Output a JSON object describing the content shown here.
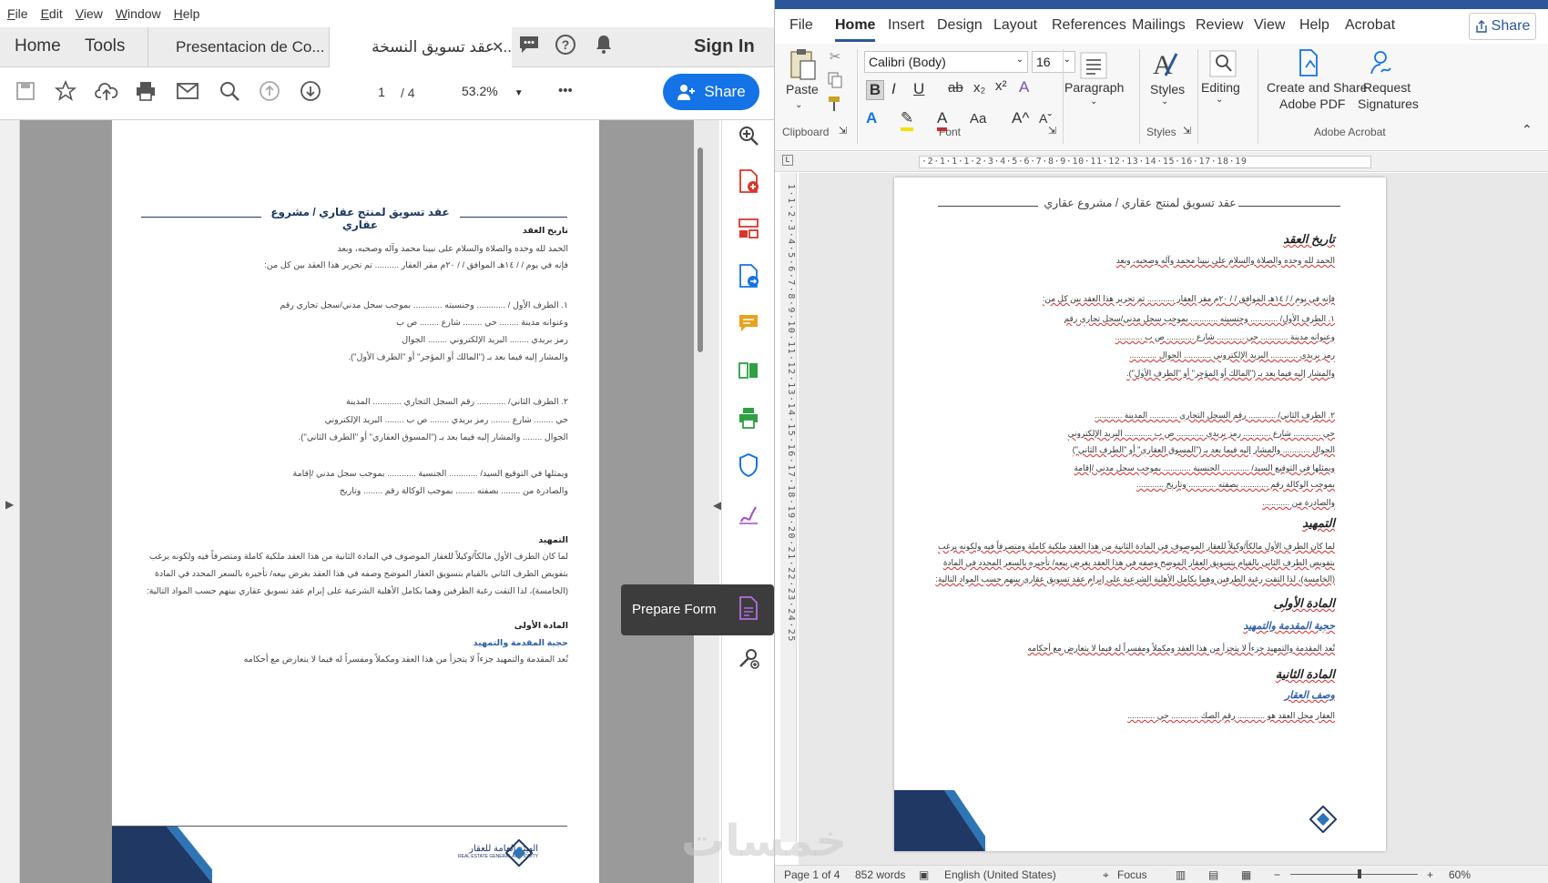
{
  "acrobat": {
    "menu": [
      "File",
      "Edit",
      "View",
      "Window",
      "Help"
    ],
    "tabs": {
      "home": "Home",
      "tools": "Tools",
      "doc1": "Presentacion de Co...",
      "doc2": "عقد تسويق النسخة ..."
    },
    "sign_in": "Sign In",
    "page_current": "1",
    "page_total": "/ 4",
    "zoom": "53.2%",
    "more": "•••",
    "share_label": "Share",
    "tooltip": "Prepare Form",
    "document": {
      "title": "عقد تسويق لمنتج عقاري / مشروع عقاري",
      "lines": [
        {
          "text": "تاريخ العقد",
          "style": "b"
        },
        {
          "text": "الحمد لله وحده والصلاة والسلام على نبينا محمد وآله وصحبه، وبعد",
          "style": ""
        },
        {
          "text": "فإنه في يوم     /     /     ١٤هـ الموافق     /     /     ٢٠م مقر العقار .......... تم تحرير هذا العقد بين كل من:",
          "style": ""
        },
        {
          "text": "١. الطرف الأول / ............ وجنسيته ............ بموجب سجل مدني/سجل تجاري رقم",
          "style": ""
        },
        {
          "text": "وعنوانه مدينة ........ حي ........ شارع ........ ص ب",
          "style": ""
        },
        {
          "text": "رمز بريدي ........ البريد الإلكتروني ........ الجوال",
          "style": ""
        },
        {
          "text": "والمشار إليه فيما بعد بـ (\"المالك أو المؤجر\" أو \"الطرف الأول\").",
          "style": ""
        },
        {
          "text": "٢. الطرف الثاني/ ............ رقم السجل التجاري ............ المدينة",
          "style": ""
        },
        {
          "text": "حي ........ شارع ........ رمز بريدي ........ ص ب ........ البريد الإلكتروني",
          "style": ""
        },
        {
          "text": "الجوال ........ والمشار إليه فيما بعد بـ (\"المسوق العقاري\" أو \"الطرف الثاني\").",
          "style": ""
        },
        {
          "text": "ويمثلها في التوقيع السيد/ ............ الجنسية ............ بموجب سجل مدني /إقامة",
          "style": ""
        },
        {
          "text": "والصادرة من ........ بصفته ........ بموجب الوكالة رقم ........ وتاريخ",
          "style": ""
        },
        {
          "text": "التمهيد",
          "style": "b"
        },
        {
          "text": "لما كان الطرف الأول مالكاً/وكيلاً للعقار الموصوف في المادة الثانية من هذا العقد ملكية كاملة ومتصرفاً فيه ولكونه يرغب",
          "style": ""
        },
        {
          "text": "بتفويض الطرف الثاني بالقيام بتسويق العقار الموضح وصفه في هذا العقد بغرض بيعه/ تأجيره بالسعر المحدد في المادة",
          "style": ""
        },
        {
          "text": "(الخامسة)، لذا التقت رغبة الطرفين وهما بكامل الأهلية الشرعية على إبرام عقد تسويق عقاري بينهم حسب المواد التالية:",
          "style": ""
        },
        {
          "text": "المادة الأولى",
          "style": "b"
        },
        {
          "text": "حجية المقدمة والتمهيد",
          "style": "blue"
        },
        {
          "text": "تُعد المقدمة والتمهيد جزءاً لا يتجزأ من هذا العقد ومكملاً ومفسراً له فيما لا يتعارض مع أحكامه",
          "style": ""
        }
      ],
      "footer_logo_text": "الهيئة العامة للعقار",
      "footer_logo_sub": "REAL ESTATE GENERAL AUTHORITY"
    }
  },
  "word": {
    "tabs": [
      "File",
      "Home",
      "Insert",
      "Design",
      "Layout",
      "References",
      "Mailings",
      "Review",
      "View",
      "Help",
      "Acrobat"
    ],
    "active_tab": "Home",
    "share_label": "Share",
    "clipboard": {
      "paste": "Paste",
      "label": "Clipboard"
    },
    "font": {
      "name": "Calibri (Body)",
      "size": "16",
      "label": "Font"
    },
    "paragraph": "Paragraph",
    "styles": {
      "btn": "Styles",
      "label": "Styles"
    },
    "editing": "Editing",
    "acrobat_group": {
      "create": "Create and Share",
      "create2": "Adobe PDF",
      "request": "Request",
      "request2": "Signatures",
      "label": "Adobe Acrobat"
    },
    "ruler_h": "·2·1·1·1·2·3·4·5·6·7·8·9·10·11·12·13·14·15·16·17·18·19",
    "ruler_v": "1·1·2·3·4·5·6·7·8·9·10·11·12·13·14·15·16·17·18·19·20·21·22·23·24·25",
    "document": {
      "title": "عقد تسويق لمنتج عقاري / مشروع عقاري",
      "lines": [
        {
          "text": "تاريخ العقد",
          "style": "head"
        },
        {
          "text": "الحمد لله وحده والصلاة والسلام على نبينا محمد وآله وصحبه، وبعد",
          "style": ""
        },
        {
          "text": "فإنه في يوم / / ١٤هـ الموافق / / ٢٠م مقر العقار ............ تم تحرير هذا العقد بين كل من:",
          "style": ""
        },
        {
          "text": "١. الطرف الأول/ ............ وجنسيته ............ بموجب سجل مدني/سجل تجاري رقم",
          "style": ""
        },
        {
          "text": "وعنوانه مدينة ............ حي ............ شارع ............ ص ب ............",
          "style": ""
        },
        {
          "text": "رمز بريدي ............ البريد الإلكتروني ............ الجوال ............",
          "style": ""
        },
        {
          "text": "والمشار إليه فيما بعد بـ (\"المالك أو المؤجر\" أو \"الطرف الأول\").",
          "style": ""
        },
        {
          "text": "٢. الطرف الثاني/ ............ رقم السجل التجاري ............ المدينة ............",
          "style": ""
        },
        {
          "text": "حي ............ شارع ............ رمز بريدي ............ ص ب ............ البريد الإلكتروني",
          "style": ""
        },
        {
          "text": "الجوال ............ والمشار إليه فيما بعد بـ (\"المسوق العقاري\" أو \"الطرف الثاني\")",
          "style": ""
        },
        {
          "text": "ويمثلها في التوقيع السيد/ ............ الجنسية ............ بموجب سجل مدني /إقامة",
          "style": ""
        },
        {
          "text": "بموجب الوكالة رقم ............ بصفته ............ وتاريخ ............",
          "style": ""
        },
        {
          "text": "والصادرة من ............",
          "style": ""
        },
        {
          "text": "التمهيد",
          "style": "head"
        },
        {
          "text": "لما كان الطرف الأول مالكاً/وكيلاً للعقار الموصوف في المادة الثانية من هذا العقد ملكية كاملة ومتصرفاً فيه ولكونه يرغب",
          "style": ""
        },
        {
          "text": "بتفويض الطرف الثاني بالقيام بتسويق العقار الموضح وصفه في هذا العقد بغرض بيعه/ تأجيره بالسعر المحدد في المادة",
          "style": ""
        },
        {
          "text": "(الخامسة)، لذا التقت رغبة الطرفين وهما بكامل الأهلية الشرعية على إبرام عقد تسويق عقاري بينهم حسب المواد التالية:",
          "style": ""
        },
        {
          "text": "المادة الأولى",
          "style": "head"
        },
        {
          "text": "حجية المقدمة والتمهيد",
          "style": "sub"
        },
        {
          "text": "تُعد المقدمة والتمهيد جزءاً لا يتجزأ من هذا العقد ومكملاً ومفسراً له فيما لا يتعارض مع أحكامه",
          "style": ""
        },
        {
          "text": "المادة الثانية",
          "style": "head"
        },
        {
          "text": "وصف العقار",
          "style": "sub"
        },
        {
          "text": "العقار محل العقد هو ............ رقم الصك ............ حي ............",
          "style": ""
        }
      ]
    },
    "status": {
      "page": "Page 1 of 4",
      "words": "852 words",
      "language": "English (United States)",
      "focus": "Focus",
      "zoom": "60%"
    }
  },
  "watermark": "خمسات"
}
